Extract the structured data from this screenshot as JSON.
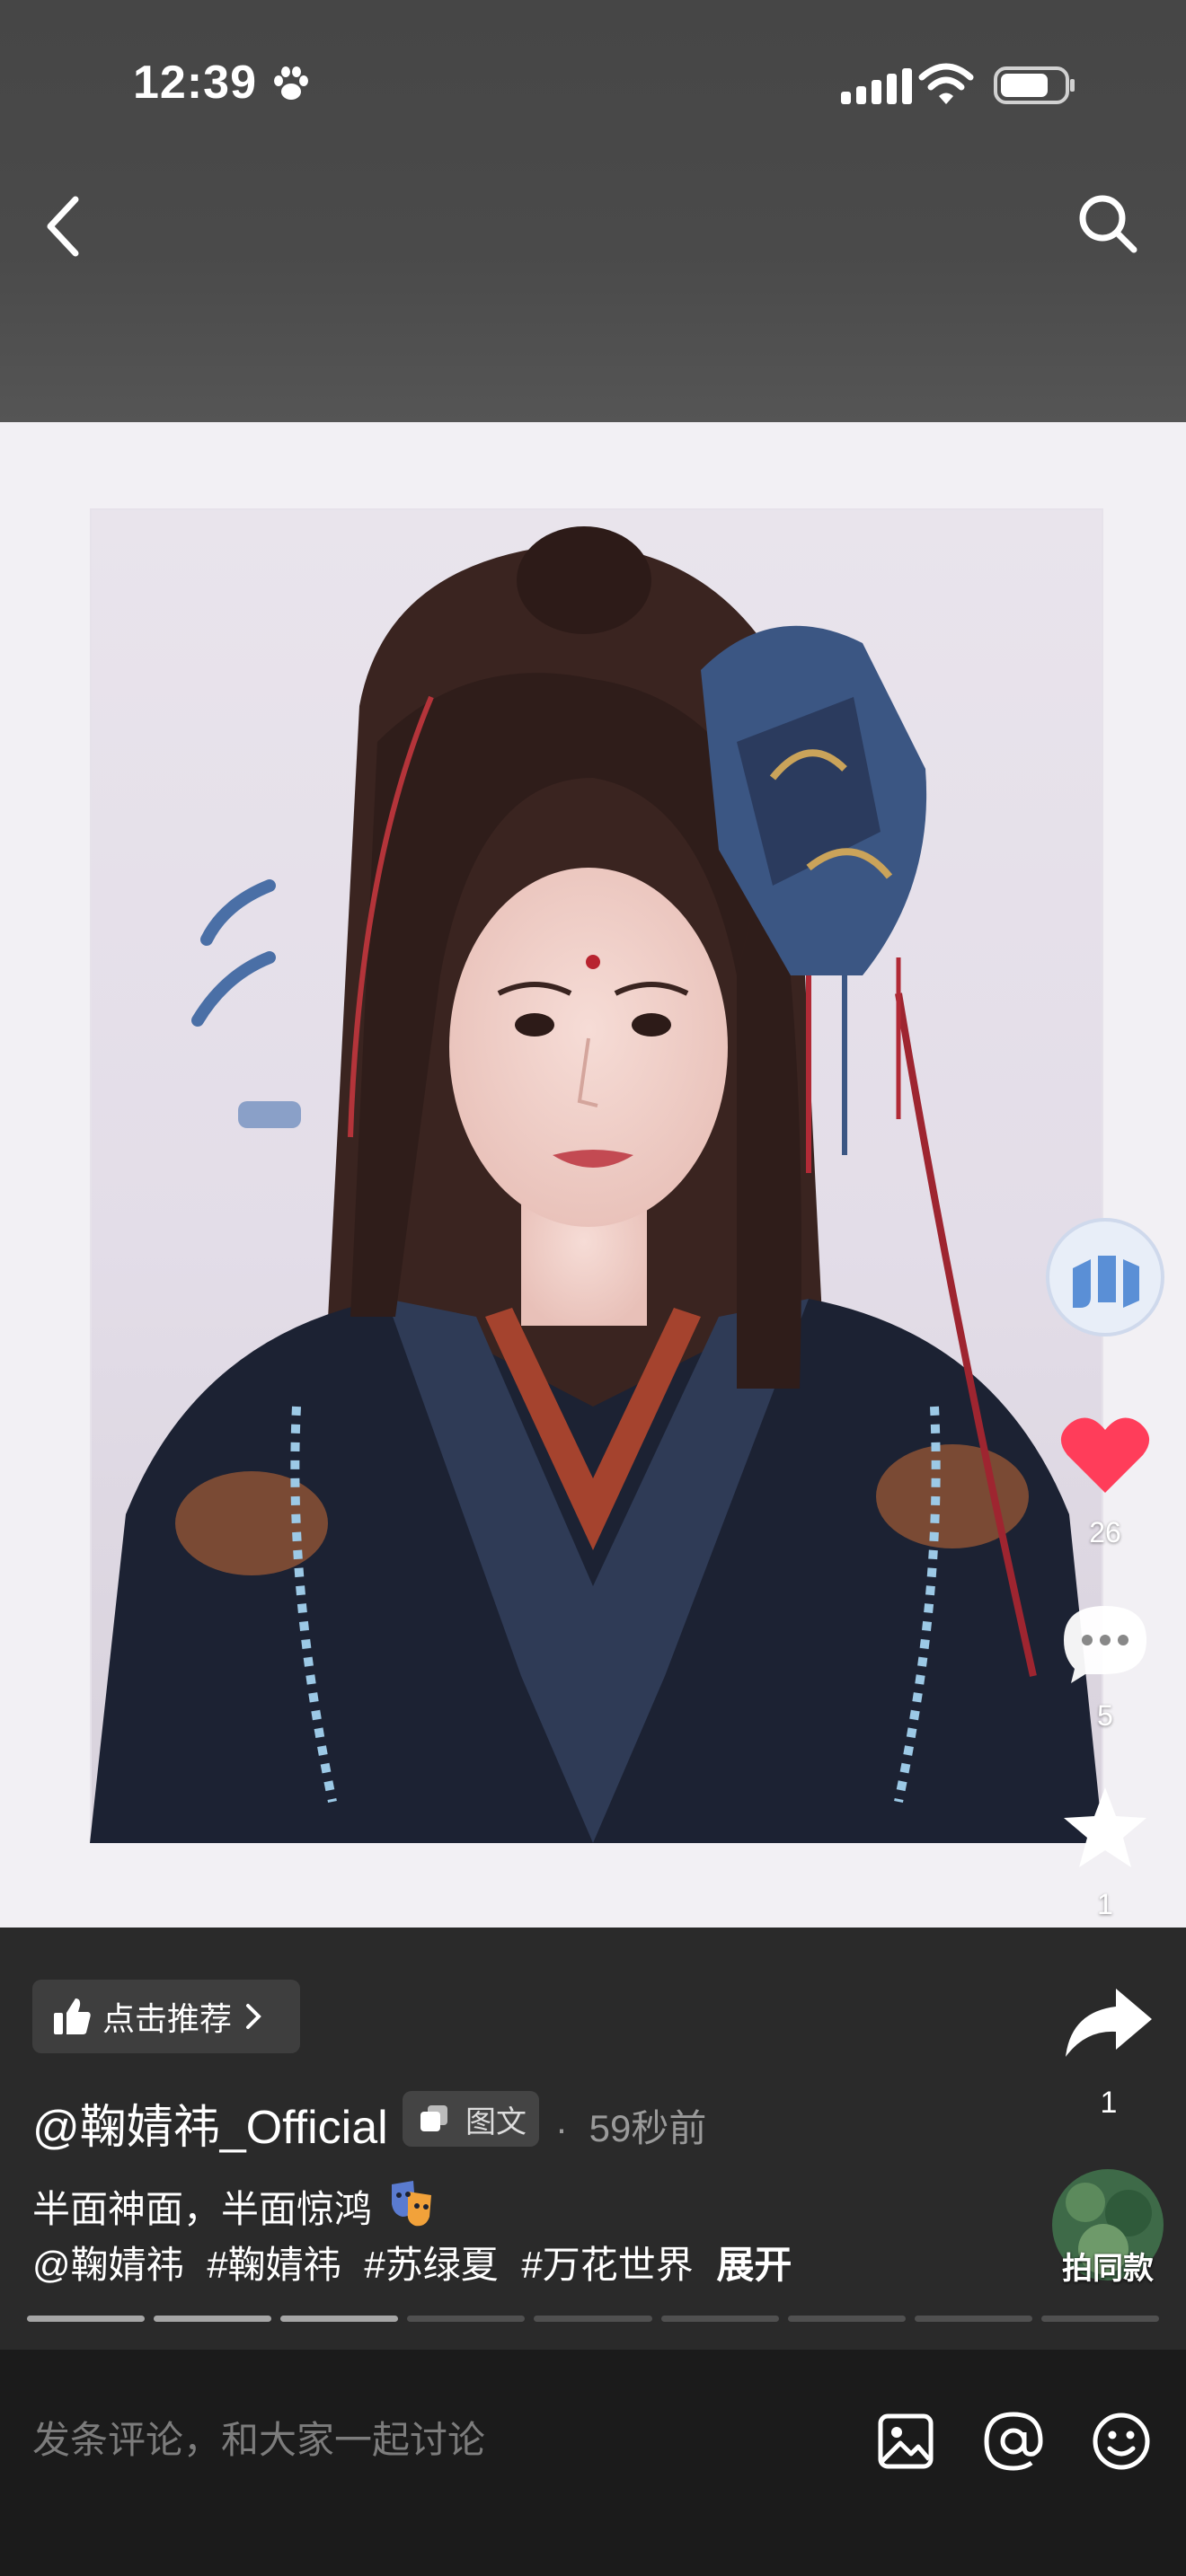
{
  "status_bar": {
    "time": "12:39"
  },
  "post": {
    "recommend_label": "点击推荐",
    "author": "@鞠婧祎_Official",
    "type_badge": "图文",
    "dot": "·",
    "time_ago": "59秒前",
    "caption_line1": "半面神面，半面惊鸿",
    "tags": [
      "@鞠婧祎",
      "#鞠婧祎",
      "#苏绿夏",
      "#万花世界"
    ],
    "expand": "展开",
    "image_count": 9,
    "current_image": 3
  },
  "actions": {
    "likes": "26",
    "comments": "5",
    "favorites": "1",
    "shares": "1",
    "same_style": "拍同款"
  },
  "comment_bar": {
    "placeholder": "发条评论，和大家一起讨论"
  },
  "colors": {
    "like": "#ff3d5a",
    "accent_blue": "#5a8fd6"
  },
  "icons": [
    "paw-icon",
    "cellular-signal-icon",
    "wifi-icon",
    "battery-icon",
    "back-arrow-icon",
    "search-icon",
    "thumbs-up-icon",
    "chevron-right-icon",
    "gallery-badge-icon",
    "theater-masks-icon",
    "heart-icon",
    "comment-bubble-icon",
    "star-icon",
    "share-arrow-icon",
    "image-icon",
    "at-sign-icon",
    "smiley-icon"
  ]
}
